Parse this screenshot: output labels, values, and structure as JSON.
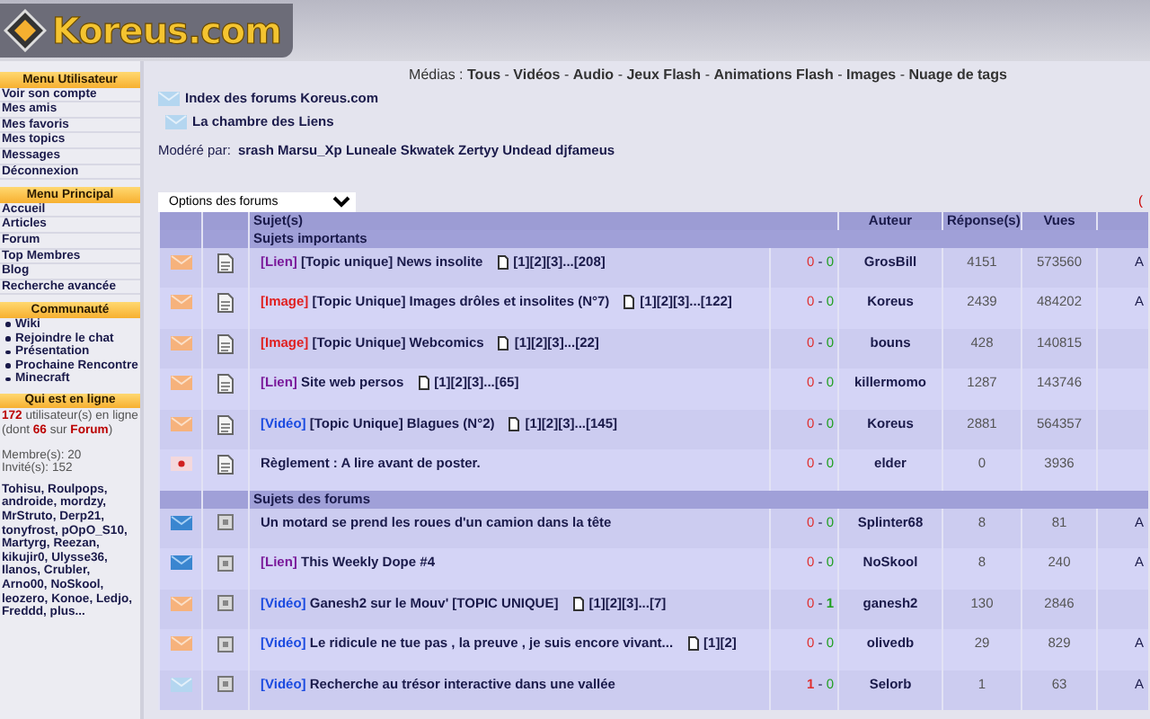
{
  "header": {
    "logo_text": "Koreus.com"
  },
  "sidebar": [
    {
      "title": "Menu Utilisateur",
      "kind": "links",
      "items": [
        "Voir son compte",
        "Mes amis",
        "Mes favoris",
        "Mes topics",
        "Messages",
        "Déconnexion"
      ]
    },
    {
      "title": "Menu Principal",
      "kind": "links",
      "items": [
        "Accueil",
        "Articles",
        "Forum",
        "Top Membres",
        "Blog",
        "Recherche avancée"
      ]
    },
    {
      "title": "Communauté",
      "kind": "bullets",
      "items": [
        "Wiki",
        "Rejoindre le chat",
        "Présentation",
        "Prochaine Rencontre",
        "Minecraft"
      ]
    },
    {
      "title": "Qui est en ligne",
      "kind": "online",
      "summary": "**172** utilisateur(s) en ligne (dont **66** sur **Forum**)",
      "counts": [
        "Membre(s): 20",
        "Invité(s): 152"
      ],
      "users": "Tohisu, Roulpops, androide, mordzy, MrStruto, Derp21, tonyfrost, pOpO_S10, Martyrg, Reezan, kikujir0, Ulysse36, Ilanos, Crubler, Arno00, NoSkool, leozero, Konoe, Ledjo, Freddd, plus..."
    }
  ],
  "media_bar": {
    "label": "Médias :",
    "links": [
      {
        "text": "Tous"
      },
      {
        "separator": "-",
        "text": "Vidéos"
      },
      {
        "separator": "-",
        "text": "Audio"
      },
      {
        "separator": "-",
        "text": "Jeux Flash"
      },
      {
        "separator": "-",
        "text": "Animations Flash"
      },
      {
        "separator": "-",
        "text": "Images"
      },
      {
        "separator": "-",
        "text": "Nuage de tags"
      }
    ]
  },
  "breadcrumb": [
    "Index des forums Koreus.com",
    "La chambre des Liens"
  ],
  "moderators": {
    "label": "Modéré par:",
    "names": "srash Marsu_Xp Luneale Skwatek Zertyy Undead djfameus"
  },
  "options": {
    "value": "Options des forums",
    "edge_mark": "("
  },
  "table": {
    "columns": [
      "Sujet(s)",
      "Auteur",
      "Réponse(s)",
      "Vues"
    ],
    "sections": [
      {
        "title": "Sujets importants",
        "kind": "sticky",
        "rows": [
          {
            "kind": "hot",
            "tag": {
              "text": "[Lien]",
              "color": "#7a1a9a"
            },
            "title": "[Topic unique] News insolite",
            "pages": "[1][2][3]...[208]",
            "minus": "0",
            "separator": "-",
            "plus": "0",
            "author": "GrosBill",
            "replies": "4151",
            "views": "573560",
            "column_6": "A"
          },
          {
            "kind": "hot",
            "tag": {
              "text": "[Image]",
              "color": "#e02020"
            },
            "title": "[Topic Unique] Images drôles et insolites (N°7)",
            "pages": "[1][2][3]...[122]",
            "minus": "0",
            "separator": "-",
            "plus": "0",
            "author": "Koreus",
            "replies": "2439",
            "views": "484202",
            "column_6": "A"
          },
          {
            "kind": "hot",
            "tag": {
              "text": "[Image]",
              "color": "#e02020"
            },
            "title": "[Topic Unique] Webcomics",
            "pages": "[1][2][3]...[22]",
            "minus": "0",
            "separator": "-",
            "plus": "0",
            "author": "bouns",
            "replies": "428",
            "views": "140815"
          },
          {
            "kind": "hot",
            "tag": {
              "text": "[Lien]",
              "color": "#7a1a9a"
            },
            "title": "Site web persos",
            "pages": "[1][2][3]...[65]",
            "minus": "0",
            "separator": "-",
            "plus": "0",
            "author": "killermomo",
            "replies": "1287",
            "views": "143746"
          },
          {
            "kind": "hot",
            "tag": {
              "text": "[Vidéo]",
              "color": "#1a4ae0"
            },
            "title": "[Topic Unique] Blagues (N°2)",
            "pages": "[1][2][3]...[145]",
            "minus": "0",
            "separator": "-",
            "plus": "0",
            "author": "Koreus",
            "replies": "2881",
            "views": "564357"
          },
          {
            "kind": "rule",
            "title": "Règlement : A lire avant de poster.",
            "minus": "0",
            "separator": "-",
            "plus": "0",
            "author": "elder",
            "replies": "0",
            "views": "3936"
          }
        ]
      },
      {
        "title": "Sujets des forums",
        "kind": "normal",
        "rows": [
          {
            "kind": "new",
            "title": "Un motard se prend les roues d'un camion dans la tête",
            "minus": "0",
            "separator": "-",
            "plus": "0",
            "author": "Splinter68",
            "replies": "8",
            "views": "81",
            "column_6": "A"
          },
          {
            "kind": "new",
            "tag": {
              "text": "[Lien]",
              "color": "#7a1a9a"
            },
            "title": "This Weekly Dope #4",
            "minus": "0",
            "separator": "-",
            "plus": "0",
            "author": "NoSkool",
            "replies": "8",
            "views": "240",
            "column_6": "A"
          },
          {
            "kind": "hot",
            "tag": {
              "text": "[Vidéo]",
              "color": "#1a4ae0"
            },
            "title": "Ganesh2 sur le Mouv' [TOPIC UNIQUE]",
            "pages": "[1][2][3]...[7]",
            "minus": "0",
            "separator": "-",
            "plus": "1",
            "author": "ganesh2",
            "replies": "130",
            "views": "2846"
          },
          {
            "kind": "hot",
            "tag": {
              "text": "[Vidéo]",
              "color": "#1a4ae0"
            },
            "title": "Le ridicule ne tue pas , la preuve , je suis encore vivant...",
            "pages": "[1][2]",
            "minus": "0",
            "separator": "-",
            "plus": "0",
            "author": "olivedb",
            "replies": "29",
            "views": "829",
            "column_6": "A"
          },
          {
            "kind": "old",
            "tag": {
              "text": "[Vidéo]",
              "color": "#1a4ae0"
            },
            "title": "Recherche au trésor interactive dans une vallée",
            "minus": "1",
            "separator": "-",
            "plus": "0",
            "author": "Selorb",
            "replies": "1",
            "views": "63",
            "column_6": "A"
          }
        ]
      }
    ]
  }
}
